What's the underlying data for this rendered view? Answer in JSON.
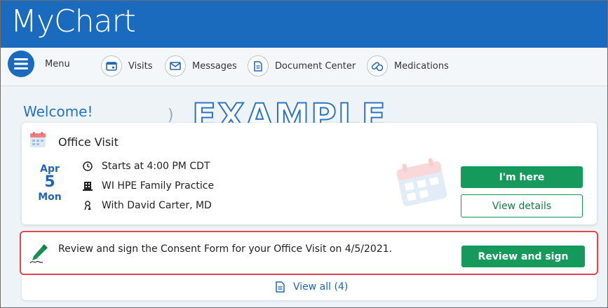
{
  "app": {
    "logo_text": "MyChart"
  },
  "nav": {
    "menu_label": "Menu",
    "items": [
      {
        "label": "Visits",
        "icon": "calendar-icon"
      },
      {
        "label": "Messages",
        "icon": "envelope-icon"
      },
      {
        "label": "Document Center",
        "icon": "document-icon"
      },
      {
        "label": "Medications",
        "icon": "pills-icon"
      }
    ]
  },
  "main": {
    "welcome": "Welcome!",
    "watermark": "EXAMPLE",
    "visit": {
      "title": "Office Visit",
      "month": "Apr",
      "day": "5",
      "weekday": "Mon",
      "time": "Starts at 4:00 PM CDT",
      "location": "WI HPE Family Practice",
      "provider": "With David Carter, MD",
      "primary_button": "I'm here",
      "secondary_button": "View details"
    },
    "task": {
      "text": "Review and sign the Consent Form for your Office Visit on 4/5/2021.",
      "button": "Review and sign"
    },
    "view_all": "View all (4)"
  },
  "colors": {
    "header_blue": "#1a6bbd",
    "welcome_blue": "#2373c4",
    "button_green": "#159a5b",
    "highlight_red": "#e0494a"
  }
}
